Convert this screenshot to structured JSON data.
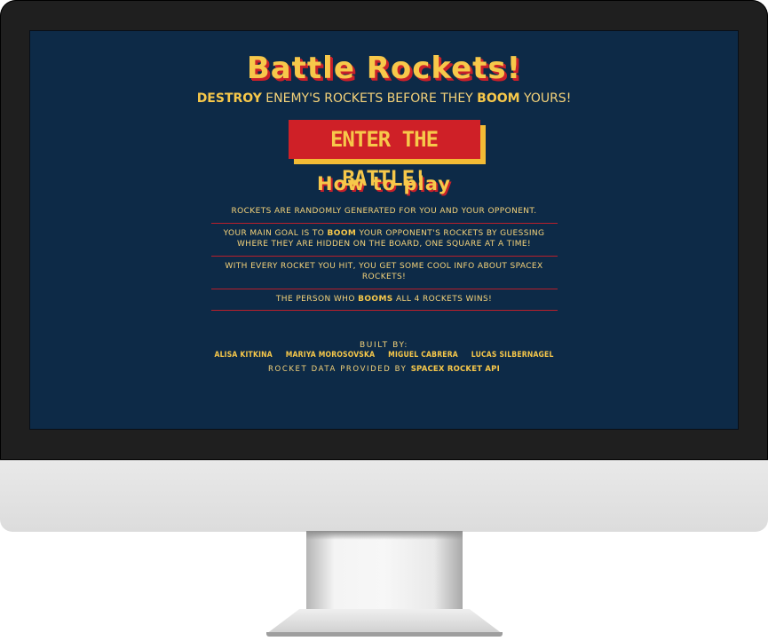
{
  "game": {
    "title": "Battle Rockets!",
    "tagline": {
      "word1": "DESTROY",
      "middle": " ENEMY'S ROCKETS BEFORE THEY ",
      "word2": "BOOM",
      "end": " YOURS!"
    },
    "enter_button": "ENTER THE BATTLE!"
  },
  "how_to_play": {
    "heading": "How to play",
    "rule1": "ROCKETS ARE RANDOMLY GENERATED FOR YOU AND YOUR OPPONENT.",
    "rule2_a": "YOUR MAIN GOAL IS TO ",
    "rule2_bold": "BOOM",
    "rule2_b": " YOUR OPPONENT'S ROCKETS BY GUESSING WHERE THEY ARE HIDDEN ON THE BOARD, ONE SQUARE AT A TIME!",
    "rule3": "WITH EVERY ROCKET YOU HIT, YOU GET SOME COOL INFO ABOUT SPACEX ROCKETS!",
    "rule4_a": "THE PERSON WHO ",
    "rule4_bold": "BOOMS",
    "rule4_b": " ALL 4 ROCKETS WINS!"
  },
  "credits": {
    "built_by": "BUILT BY:",
    "authors": [
      "ALISA KITKINA",
      "MARIYA MOROSOVSKA",
      "MIGUEL CABRERA",
      "LUCAS SILBERNAGEL"
    ],
    "provided_text": "ROCKET DATA PROVIDED BY ",
    "provided_link": "SPACEX ROCKET API"
  },
  "colors": {
    "screen_bg": "#0d2a47",
    "accent_yellow": "#f7c84a",
    "accent_red": "#cf2027"
  }
}
